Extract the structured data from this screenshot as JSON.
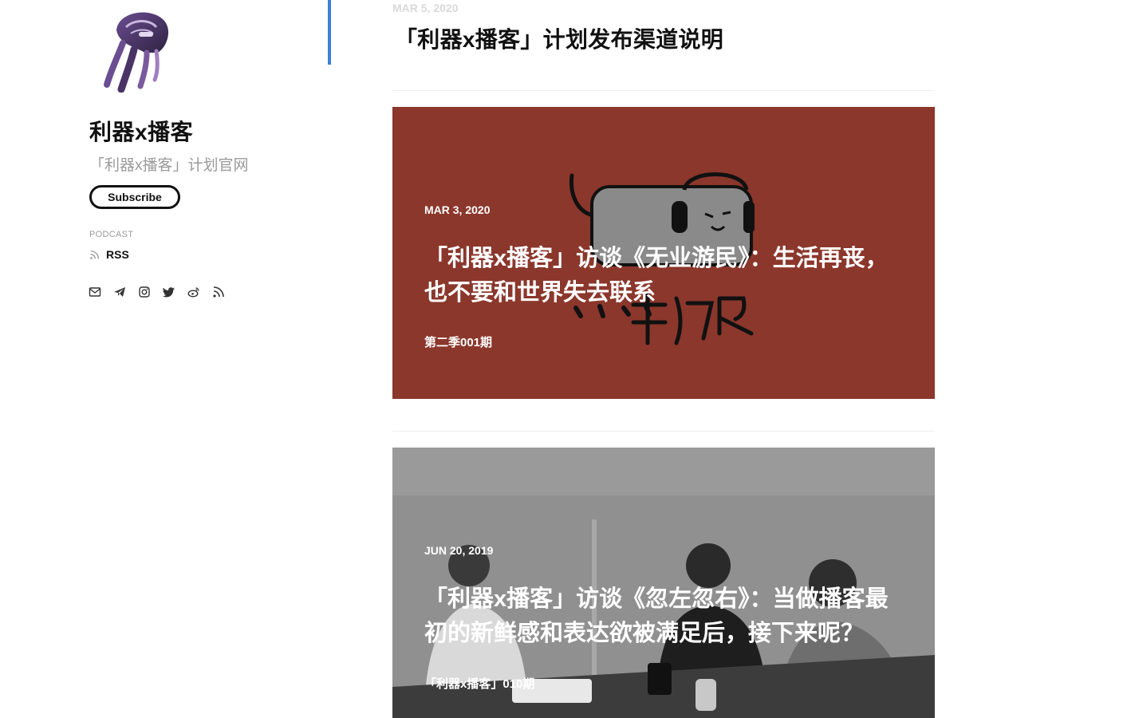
{
  "sidebar": {
    "title": "利器x播客",
    "description": "「利器x播客」计划官网",
    "subscribe_label": "Subscribe",
    "section_label": "PODCAST",
    "rss_label": "RSS",
    "social_icons": [
      "mail-icon",
      "telegram-icon",
      "instagram-icon",
      "twitter-icon",
      "weibo-icon",
      "rss-icon"
    ]
  },
  "posts": [
    {
      "date": "MAR 5, 2020",
      "title": "「利器x播客」计划发布渠道说明"
    },
    {
      "date": "MAR 3, 2020",
      "title": "「利器x播客」访谈《无业游民》：生活再丧，也不要和世界失去联系",
      "tag": "第二季001期",
      "background": "#8b372c"
    },
    {
      "date": "JUN 20, 2019",
      "title": "「利器x播客」访谈《忽左忽右》：当做播客最初的新鲜感和表达欲被满足后，接下来呢？",
      "tag": "「利器x播客」010期",
      "background": "#8e8e8e"
    }
  ],
  "colors": {
    "accent": "#3b7fd8",
    "card_red": "#8b372c",
    "card_gray": "#8e8e8e"
  }
}
